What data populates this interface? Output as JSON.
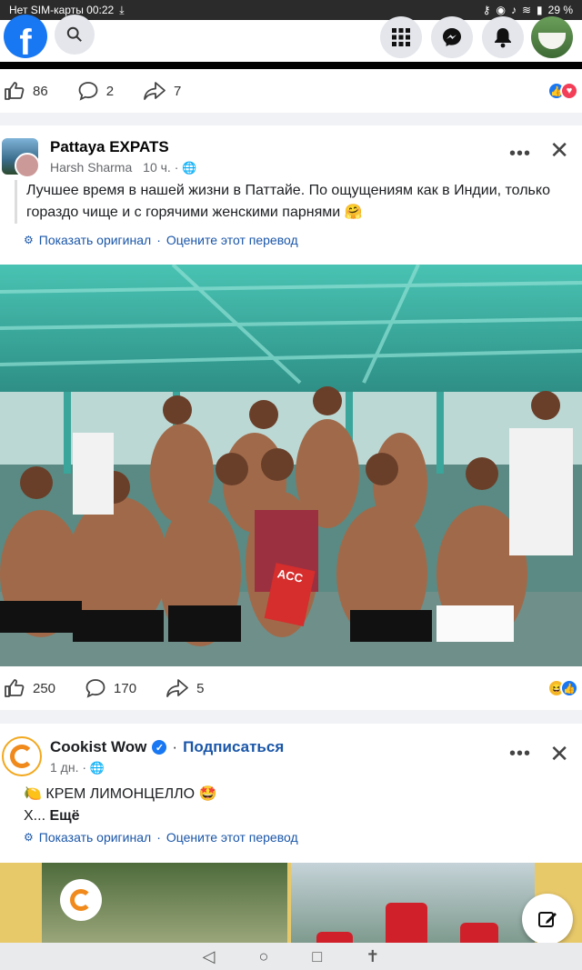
{
  "status": {
    "left": "Нет SIM-карты 00:22",
    "battery": "29 %"
  },
  "header": {
    "logo": "f"
  },
  "prev_post": {
    "likes": "86",
    "comments": "2",
    "shares": "7"
  },
  "post1": {
    "group": "Pattaya EXPATS",
    "author": "Harsh Sharma",
    "time": "10 ч. ·",
    "text": "Лучшее время в нашей жизни в Паттайе. По ощущениям как в Индии, только гораздо чище и с горячими женскими парнями 🤗",
    "show_original": "Показать оригинал",
    "rate_translation": "Оцените этот перевод",
    "sign_text": "ACC",
    "likes": "250",
    "comments": "170",
    "shares": "5"
  },
  "post2": {
    "name": "Cookist Wow",
    "subscribe": "Подписаться",
    "time": "1 дн. ·",
    "text_line1": "🍋 КРЕМ ЛИМОНЦЕЛЛО 🤩",
    "text_line2_prefix": "X...",
    "see_more": "Ещё",
    "show_original": "Показать оригинал",
    "rate_translation": "Оцените этот перевод"
  },
  "colors": {
    "fb_blue": "#1877f2",
    "link_blue": "#1a56a8"
  }
}
